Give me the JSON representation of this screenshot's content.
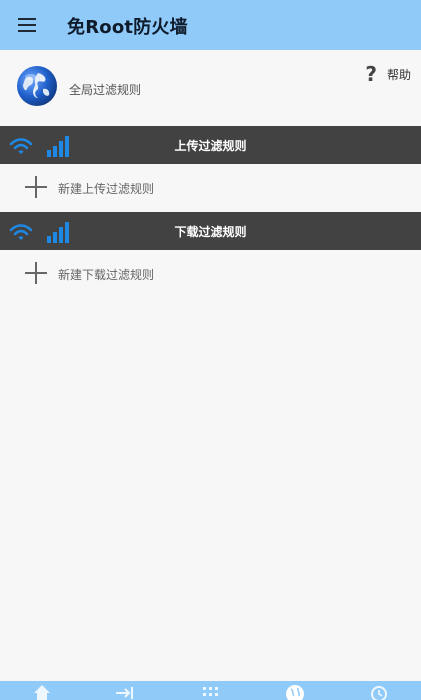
{
  "appbar": {
    "title": "免Root防火墙",
    "menu_icon": "menu-icon"
  },
  "global": {
    "label": "全局过滤规则",
    "icon": "globe-icon"
  },
  "help": {
    "symbol": "?",
    "label": "帮助"
  },
  "upload_section": {
    "title": "上传过滤规则",
    "new_label": "新建上传过滤规则"
  },
  "download_section": {
    "title": "下载过滤规则",
    "new_label": "新建下载过滤规则"
  },
  "bottom_nav": {
    "items": [
      "home-icon",
      "export-arrow-icon",
      "apps-grid-icon",
      "globe-icon",
      "history-icon"
    ]
  },
  "colors": {
    "appbar": "#90caf9",
    "section_bar": "#424242",
    "accent": "#1e88e5",
    "background": "#f7f7f7"
  }
}
